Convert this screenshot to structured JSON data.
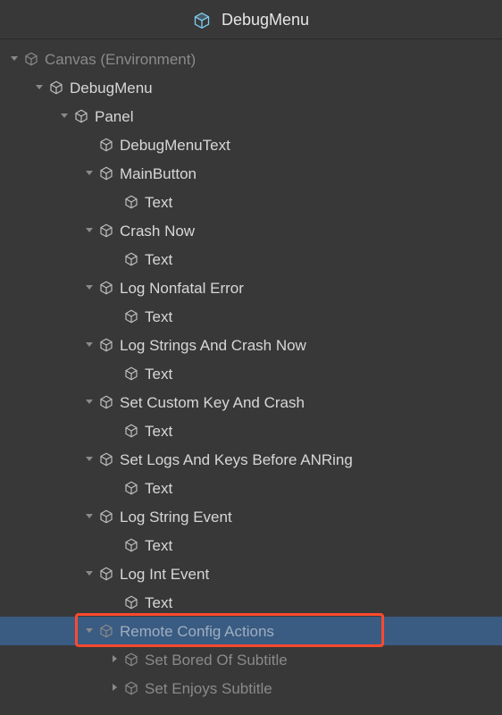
{
  "topbar": {
    "title": "DebugMenu"
  },
  "tree": [
    {
      "id": "canvas",
      "depth": 0,
      "arrow": "down",
      "label": "Canvas (Environment)",
      "dimmed": true
    },
    {
      "id": "debugmenu",
      "depth": 1,
      "arrow": "down",
      "label": "DebugMenu"
    },
    {
      "id": "panel",
      "depth": 2,
      "arrow": "down",
      "label": "Panel"
    },
    {
      "id": "dmtext",
      "depth": 3,
      "arrow": "none",
      "label": "DebugMenuText"
    },
    {
      "id": "mainbtn",
      "depth": 3,
      "arrow": "down",
      "label": "MainButton"
    },
    {
      "id": "mainbtn-t",
      "depth": 4,
      "arrow": "none",
      "label": "Text"
    },
    {
      "id": "crash",
      "depth": 3,
      "arrow": "down",
      "label": "Crash Now"
    },
    {
      "id": "crash-t",
      "depth": 4,
      "arrow": "none",
      "label": "Text"
    },
    {
      "id": "nfe",
      "depth": 3,
      "arrow": "down",
      "label": "Log Nonfatal Error"
    },
    {
      "id": "nfe-t",
      "depth": 4,
      "arrow": "none",
      "label": "Text"
    },
    {
      "id": "lsc",
      "depth": 3,
      "arrow": "down",
      "label": "Log Strings And Crash Now"
    },
    {
      "id": "lsc-t",
      "depth": 4,
      "arrow": "none",
      "label": "Text"
    },
    {
      "id": "sck",
      "depth": 3,
      "arrow": "down",
      "label": "Set Custom Key And Crash"
    },
    {
      "id": "sck-t",
      "depth": 4,
      "arrow": "none",
      "label": "Text"
    },
    {
      "id": "anr",
      "depth": 3,
      "arrow": "down",
      "label": "Set Logs And Keys Before ANRing"
    },
    {
      "id": "anr-t",
      "depth": 4,
      "arrow": "none",
      "label": "Text"
    },
    {
      "id": "lse",
      "depth": 3,
      "arrow": "down",
      "label": "Log String Event"
    },
    {
      "id": "lse-t",
      "depth": 4,
      "arrow": "none",
      "label": "Text"
    },
    {
      "id": "lie",
      "depth": 3,
      "arrow": "down",
      "label": "Log Int Event"
    },
    {
      "id": "lie-t",
      "depth": 4,
      "arrow": "none",
      "label": "Text"
    },
    {
      "id": "rca",
      "depth": 3,
      "arrow": "down",
      "label": "Remote Config Actions",
      "selected": true,
      "dimmed": true
    },
    {
      "id": "bored",
      "depth": 4,
      "arrow": "right",
      "label": "Set Bored Of Subtitle",
      "dimmed": true
    },
    {
      "id": "enjoys",
      "depth": 4,
      "arrow": "right",
      "label": "Set Enjoys Subtitle",
      "dimmed": true
    }
  ],
  "highlight": {
    "target": "rca"
  },
  "colors": {
    "topCube": "#7ecaf0",
    "grayCube": "#8a8a8a",
    "arrow": "#8a8a8a",
    "selectRow": "#3a5b82",
    "highlight": "#ff4a2e"
  }
}
